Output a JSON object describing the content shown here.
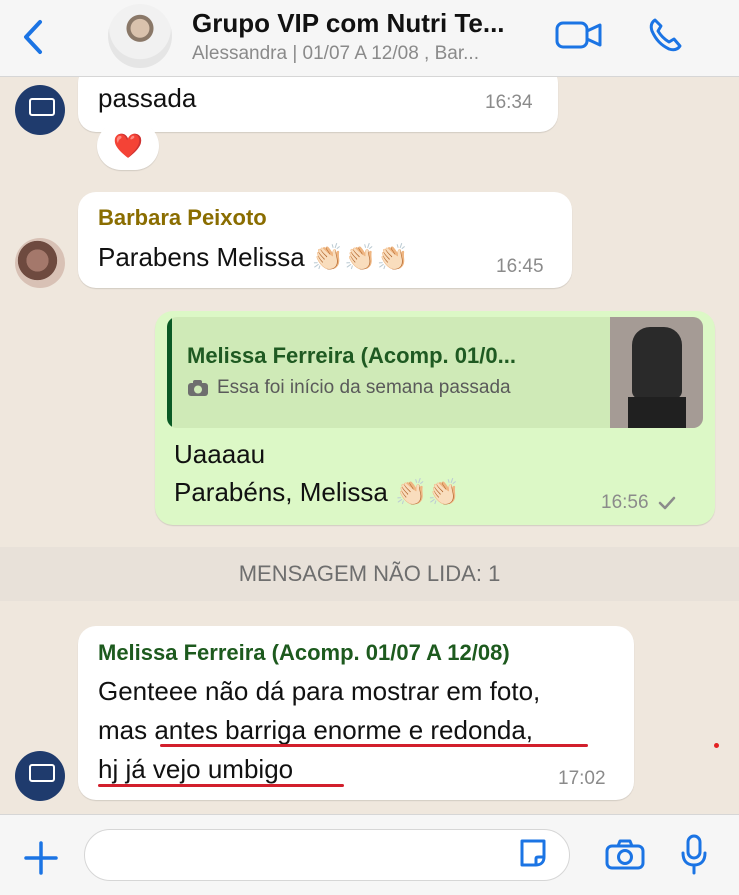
{
  "header": {
    "title": "Grupo VIP com Nutri Te...",
    "subtitle": "Alessandra | 01/07 A 12/08 , Bar..."
  },
  "messages": {
    "m1": {
      "text": "passada",
      "time": "16:34",
      "reaction": "❤️"
    },
    "m2": {
      "sender": "Barbara  Peixoto",
      "sender_color": "#8a6d00",
      "text": "Parabens Melissa 👏🏻👏🏻👏🏻",
      "time": "16:45"
    },
    "m3": {
      "quoted_sender": "Melissa Ferreira (Acomp. 01/0...",
      "quoted_text": "Essa foi início da semana passada",
      "line1": "Uaaaau",
      "line2": "Parabéns, Melissa 👏🏻👏🏻",
      "time": "16:56"
    },
    "unread": "MENSAGEM NÃO LIDA: 1",
    "m4": {
      "sender": "Melissa Ferreira (Acomp. 01/07 A 12/08)",
      "sender_color": "#1d5a1e",
      "line1": "Genteee não dá para mostrar em foto,",
      "line2": "mas antes barriga enorme e redonda,",
      "line3": "hj já vejo umbigo",
      "time": "17:02"
    }
  },
  "colors": {
    "accent": "#1b74e4",
    "outgoing_bubble": "#dcf8c6",
    "underline": "#d21f2c"
  },
  "icons": {
    "back": "chevron-left-icon",
    "video": "video-camera-icon",
    "phone": "phone-icon",
    "plus": "plus-icon",
    "sticker": "sticker-icon",
    "camera": "camera-icon",
    "mic": "microphone-icon"
  }
}
